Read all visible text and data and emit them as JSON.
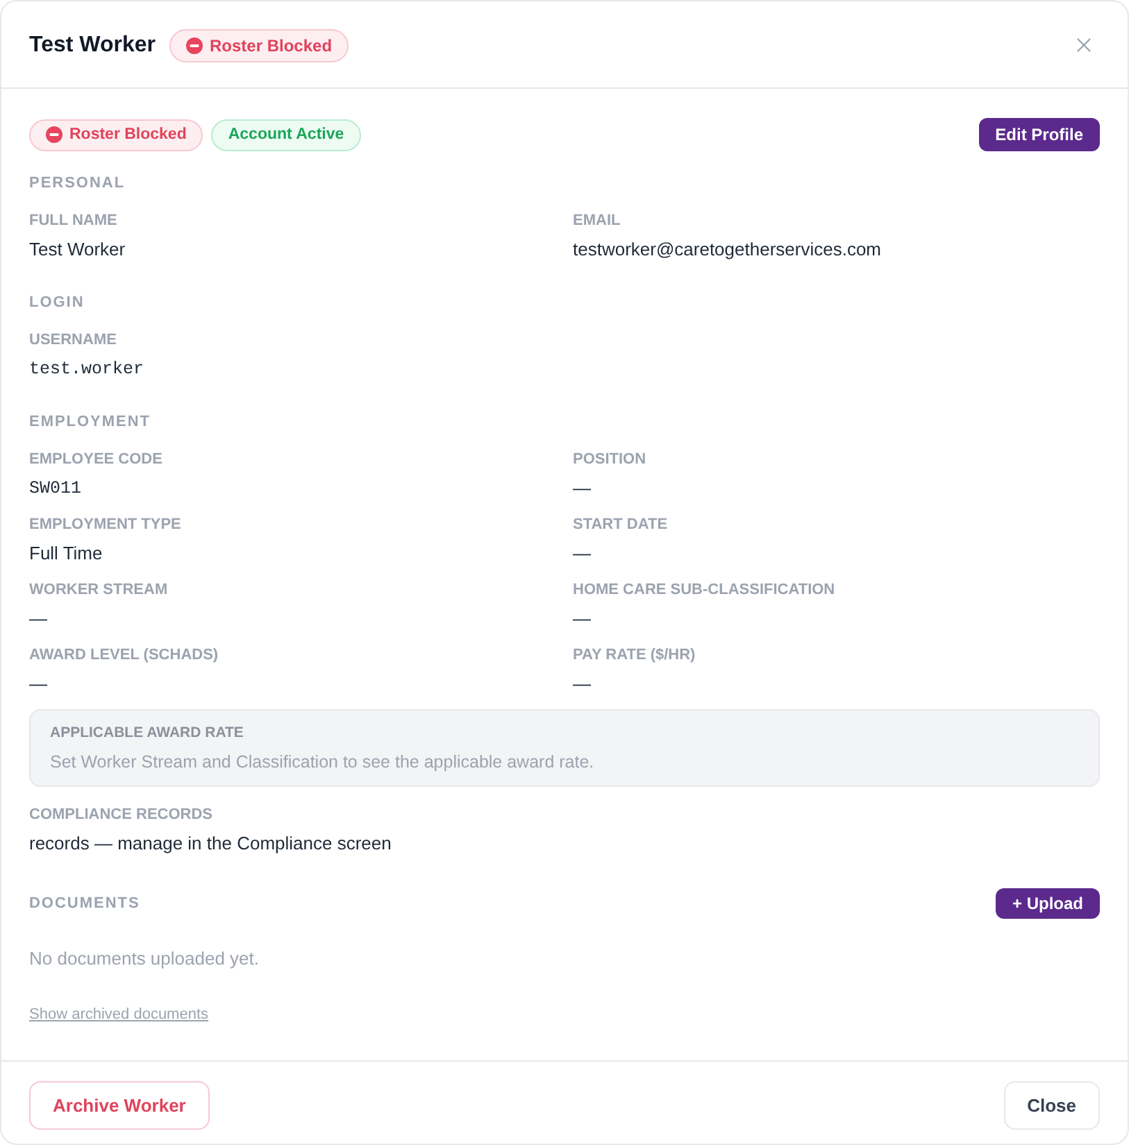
{
  "dialog": {
    "title": "Test Worker",
    "title_badges": [
      {
        "label": "Roster Blocked",
        "kind": "blocked"
      }
    ]
  },
  "status_badges": [
    {
      "label": "Roster Blocked",
      "kind": "blocked"
    },
    {
      "label": "Account Active",
      "kind": "active"
    }
  ],
  "edit_button": "Edit Profile",
  "sections": [
    {
      "heading": "PERSONAL",
      "fields": [
        {
          "label": "FULL NAME",
          "value": "Test Worker",
          "kind": "text"
        },
        {
          "label": "EMAIL",
          "value": "testworker@caretogetherservices.com",
          "kind": "text"
        }
      ]
    },
    {
      "heading": "LOGIN",
      "fields": [
        {
          "label": "USERNAME",
          "value": "test.worker",
          "kind": "code"
        }
      ]
    },
    {
      "heading": "EMPLOYMENT",
      "fields": [
        {
          "label": "EMPLOYEE CODE",
          "value": "SW011",
          "kind": "code"
        },
        {
          "label": "POSITION",
          "value": "—",
          "kind": "text"
        },
        {
          "label": "EMPLOYMENT TYPE",
          "value": "Full Time",
          "kind": "text"
        },
        {
          "label": "START DATE",
          "value": "—",
          "kind": "text"
        },
        {
          "label": "WORKER STREAM",
          "value": "—",
          "kind": "text"
        },
        {
          "label": "HOME CARE SUB-CLASSIFICATION",
          "value": "—",
          "kind": "text"
        },
        {
          "label": "AWARD LEVEL (SCHADS)",
          "value": "—",
          "kind": "text"
        },
        {
          "label": "PAY RATE ($/HR)",
          "value": "—",
          "kind": "text"
        }
      ]
    }
  ],
  "award_rate_note": {
    "title": "APPLICABLE AWARD RATE",
    "text": "Set Worker Stream and Classification to see the applicable award rate."
  },
  "compliance_records": {
    "label": "COMPLIANCE RECORDS",
    "value": "records — manage in the Compliance screen"
  },
  "documents": {
    "heading": "DOCUMENTS",
    "upload_button": "+ Upload",
    "empty_text": "No documents uploaded yet.",
    "archived_link": "Show archived documents"
  },
  "footer": {
    "archive_button": "Archive Worker",
    "close_button": "Close"
  }
}
